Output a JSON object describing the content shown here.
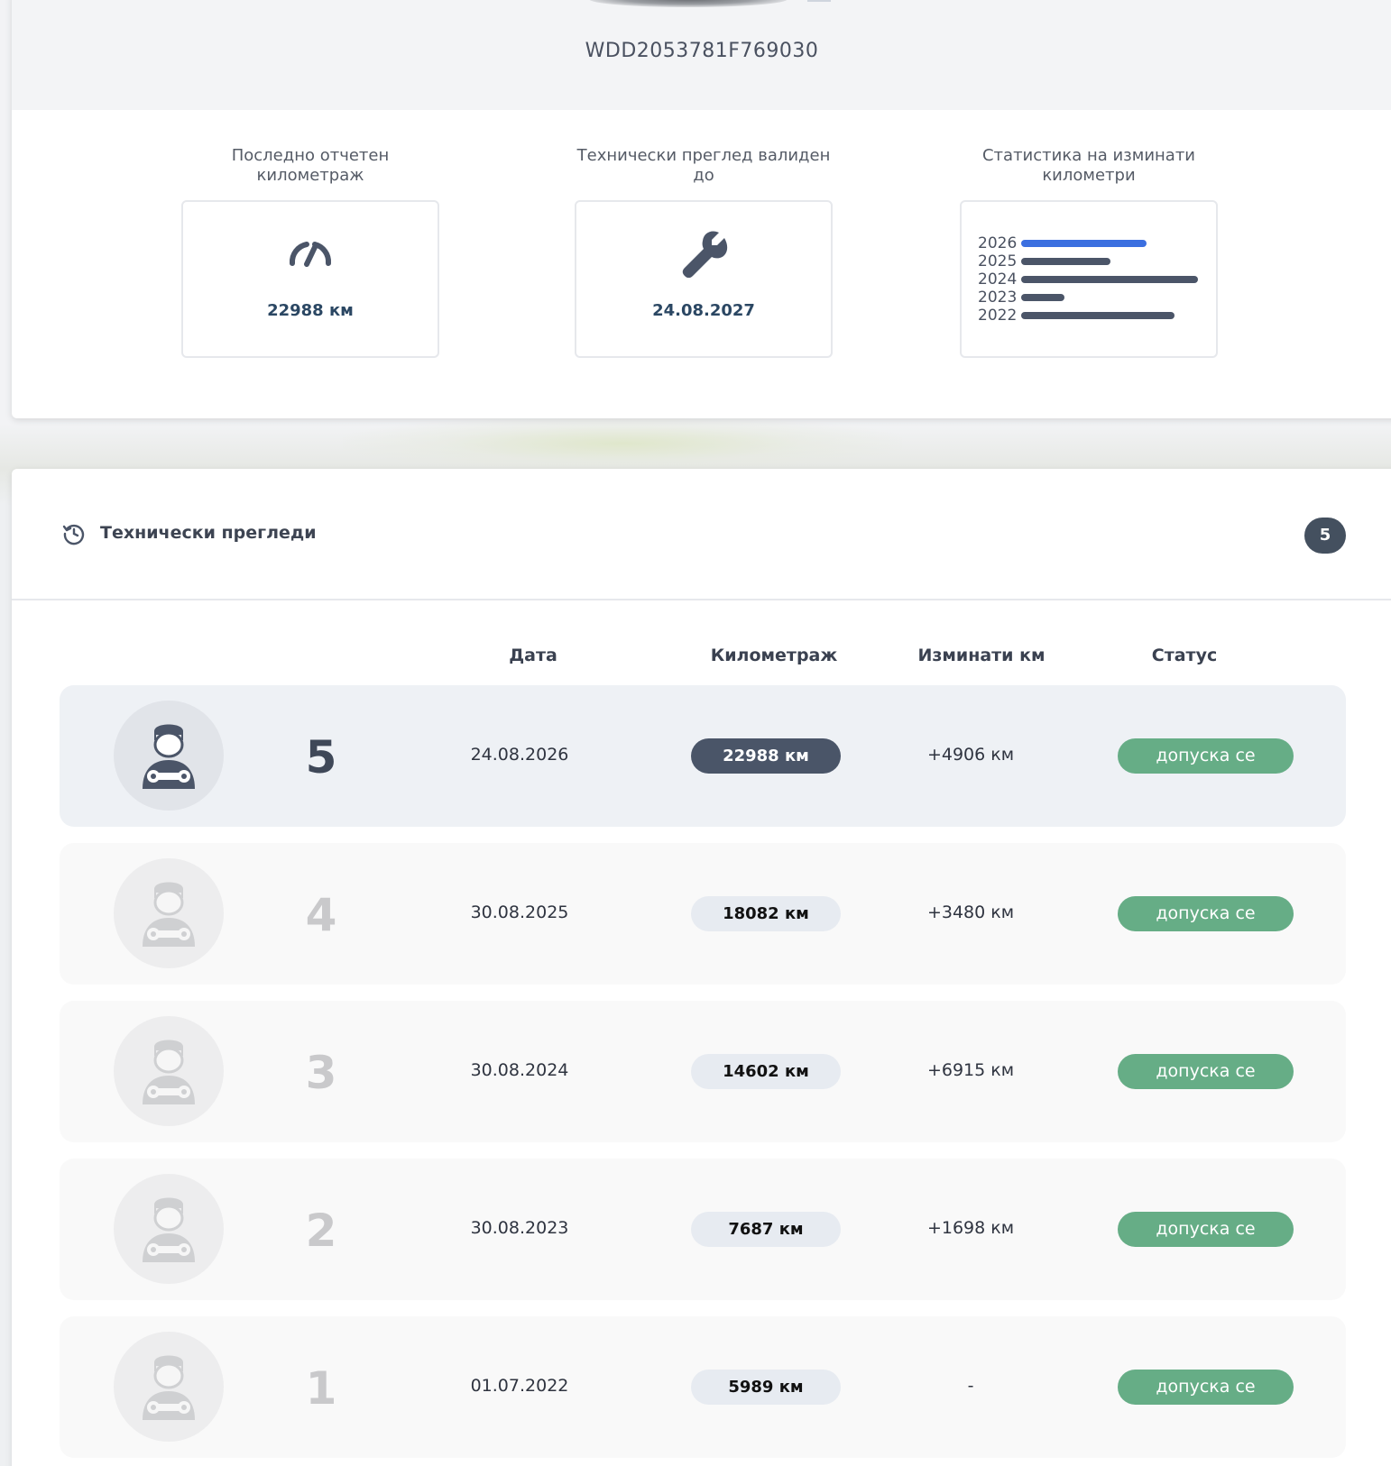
{
  "vehicle": {
    "vin": "WDD2053781F769030"
  },
  "stats": {
    "mileage": {
      "title": "Последно отчетен километраж",
      "value": "22988 км",
      "icon": "speedometer-icon"
    },
    "inspection": {
      "title": "Технически преглед валиден до",
      "value": "24.08.2027",
      "icon": "wrench-icon"
    },
    "chart": {
      "title": "Статистика на изминати километри"
    }
  },
  "chart_data": {
    "type": "bar",
    "categories": [
      "2026",
      "2025",
      "2024",
      "2023",
      "2022"
    ],
    "values": [
      4906,
      3480,
      6915,
      1698,
      5989
    ],
    "highlight": "2026",
    "colors": {
      "highlight": "#3b6fe0",
      "default": "#4b5568"
    }
  },
  "inspections": {
    "title": "Технически прегледи",
    "count": "5",
    "columns": {
      "date": "Дата",
      "mileage": "Километраж",
      "delta": "Изминати км",
      "status": "Статус"
    },
    "rows": [
      {
        "num": "5",
        "date": "24.08.2026",
        "mileage": "22988 км",
        "delta": "+4906 км",
        "status": "допуска се"
      },
      {
        "num": "4",
        "date": "30.08.2025",
        "mileage": "18082 км",
        "delta": "+3480 км",
        "status": "допуска се"
      },
      {
        "num": "3",
        "date": "30.08.2024",
        "mileage": "14602 км",
        "delta": "+6915 км",
        "status": "допуска се"
      },
      {
        "num": "2",
        "date": "30.08.2023",
        "mileage": "7687 км",
        "delta": "+1698 км",
        "status": "допуска се"
      },
      {
        "num": "1",
        "date": "01.07.2022",
        "mileage": "5989 км",
        "delta": "-",
        "status": "допуска се"
      }
    ]
  },
  "colors": {
    "status_ok": "#66ad86",
    "active_pill": "#4a5568",
    "value_text": "#2b4763"
  }
}
